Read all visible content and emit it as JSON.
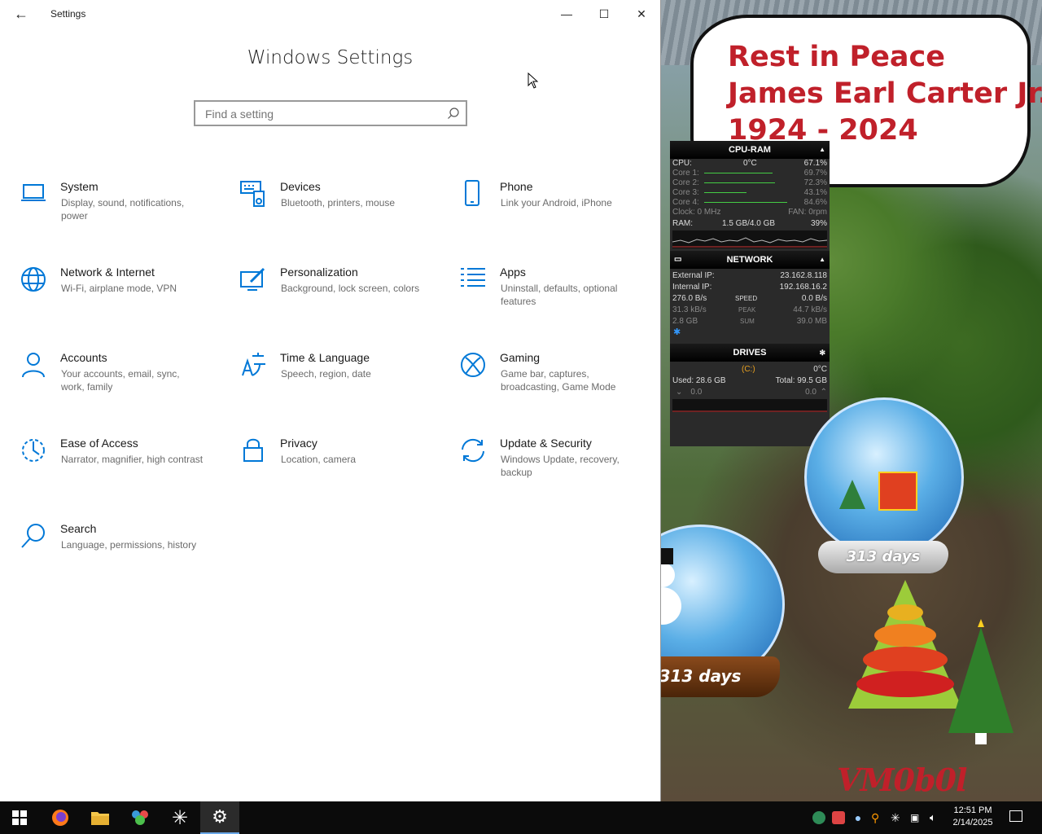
{
  "window": {
    "title": "Settings",
    "heading": "Windows Settings",
    "search_placeholder": "Find a setting"
  },
  "tiles": [
    {
      "title": "System",
      "desc": "Display, sound, notifications, power",
      "icon": "laptop-icon"
    },
    {
      "title": "Devices",
      "desc": "Bluetooth, printers, mouse",
      "icon": "keyboard-speaker-icon"
    },
    {
      "title": "Phone",
      "desc": "Link your Android, iPhone",
      "icon": "phone-icon"
    },
    {
      "title": "Network & Internet",
      "desc": "Wi-Fi, airplane mode, VPN",
      "icon": "globe-icon"
    },
    {
      "title": "Personalization",
      "desc": "Background, lock screen, colors",
      "icon": "paint-monitor-icon"
    },
    {
      "title": "Apps",
      "desc": "Uninstall, defaults, optional features",
      "icon": "list-icon"
    },
    {
      "title": "Accounts",
      "desc": "Your accounts, email, sync, work, family",
      "icon": "person-icon"
    },
    {
      "title": "Time & Language",
      "desc": "Speech, region, date",
      "icon": "time-language-icon"
    },
    {
      "title": "Gaming",
      "desc": "Game bar, captures, broadcasting, Game Mode",
      "icon": "xbox-icon"
    },
    {
      "title": "Ease of Access",
      "desc": "Narrator, magnifier, high contrast",
      "icon": "ease-of-access-icon"
    },
    {
      "title": "Privacy",
      "desc": "Location, camera",
      "icon": "lock-icon"
    },
    {
      "title": "Update & Security",
      "desc": "Windows Update, recovery, backup",
      "icon": "sync-arrows-icon"
    },
    {
      "title": "Search",
      "desc": "Language, permissions, history",
      "icon": "search-icon"
    }
  ],
  "wallpaper": {
    "tribute_lines": [
      "Rest in Peace",
      "James Earl Carter Jr.",
      "1924 - 2024"
    ],
    "globe_right_label": "313 days",
    "globe_left_label": "313 days",
    "signature": "VM0b0l"
  },
  "gadget": {
    "cpu_ram": {
      "title": "CPU-RAM",
      "temp": "0°C",
      "cpu_label": "CPU:",
      "cpu_value": "67.1%",
      "cores": [
        {
          "label": "Core 1:",
          "value": "69.7%",
          "level": 0.697
        },
        {
          "label": "Core 2:",
          "value": "72.3%",
          "level": 0.723
        },
        {
          "label": "Core 3:",
          "value": "43.1%",
          "level": 0.431
        },
        {
          "label": "Core 4:",
          "value": "84.6%",
          "level": 0.846
        }
      ],
      "clock": "Clock: 0 MHz",
      "fan": "FAN: 0rpm",
      "ram_label": "RAM:",
      "ram_value": "1.5 GB/4.0 GB",
      "ram_pct": "39%"
    },
    "network": {
      "title": "NETWORK",
      "external_label": "External IP:",
      "external_value": "23.162.8.118",
      "internal_label": "Internal IP:",
      "internal_value": "192.168.16.2",
      "rows": [
        {
          "left": "276.0 B/s",
          "mid": "SPEED",
          "right": "0.0 B/s"
        },
        {
          "left": "31.3 kB/s",
          "mid": "PEAK",
          "right": "44.7 kB/s"
        },
        {
          "left": "2.8 GB",
          "mid": "SUM",
          "right": "39.0 MB"
        }
      ]
    },
    "drives": {
      "title": "DRIVES",
      "drive": "(C:)",
      "temp": "0°C",
      "used": "Used: 28.6 GB",
      "total": "Total: 99.5 GB",
      "read": "0.0",
      "write": "0.0"
    }
  },
  "taskbar": {
    "clock_time": "12:51 PM",
    "clock_date": "2/14/2025"
  },
  "colors": {
    "accent": "#0078d7",
    "tribute_red": "#c0202a",
    "taskbar": "#0b0b0b"
  }
}
